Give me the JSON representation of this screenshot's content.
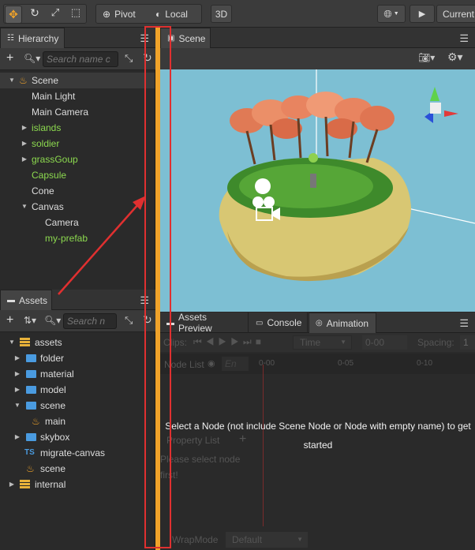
{
  "toolbar": {
    "pivot_label": "Pivot",
    "local_label": "Local",
    "mode_3d": "3D",
    "current_label": "Current"
  },
  "hierarchy": {
    "tab_label": "Hierarchy",
    "search_placeholder": "Search name c",
    "items": [
      {
        "label": "Scene",
        "color": "#dddddd"
      },
      {
        "label": "Main Light",
        "color": "#dddddd"
      },
      {
        "label": "Main Camera",
        "color": "#dddddd"
      },
      {
        "label": "islands",
        "color": "#8cd94f"
      },
      {
        "label": "soldier",
        "color": "#8cd94f"
      },
      {
        "label": "grassGoup",
        "color": "#8cd94f"
      },
      {
        "label": "Capsule",
        "color": "#8cd94f"
      },
      {
        "label": "Cone",
        "color": "#dddddd"
      },
      {
        "label": "Canvas",
        "color": "#dddddd"
      },
      {
        "label": "Camera",
        "color": "#dddddd"
      },
      {
        "label": "my-prefab",
        "color": "#8cd94f"
      }
    ]
  },
  "assets": {
    "tab_label": "Assets",
    "search_placeholder": "Search n",
    "items": [
      {
        "label": "assets"
      },
      {
        "label": "folder"
      },
      {
        "label": "material"
      },
      {
        "label": "model"
      },
      {
        "label": "scene"
      },
      {
        "label": "main"
      },
      {
        "label": "skybox"
      },
      {
        "label": "migrate-canvas"
      },
      {
        "label": "scene"
      },
      {
        "label": "internal"
      }
    ]
  },
  "scene_panel": {
    "tab_label": "Scene"
  },
  "bottom_panel": {
    "tabs": [
      "Assets Preview",
      "Console",
      "Animation"
    ],
    "clips_label": "Clips:",
    "time_select": "Time",
    "time_value": "0-00",
    "spacing_label": "Spacing:",
    "spacing_value": "1",
    "node_list_label": "Node List",
    "node_list_filter": "En",
    "ticks": [
      "0-00",
      "0-05",
      "0-10"
    ],
    "message": "Select a Node (not include Scene Node or Node with empty name) to get started",
    "property_list_label": "Property List",
    "select_node_hint": "Please select node first!",
    "wrap_mode_label": "WrapMode",
    "wrap_mode_value": "Default"
  },
  "colors": {
    "accent_orange": "#f0a32a",
    "green_node": "#8cd94f",
    "annotation_red": "#e03030",
    "sky": "#7dbfd3"
  }
}
